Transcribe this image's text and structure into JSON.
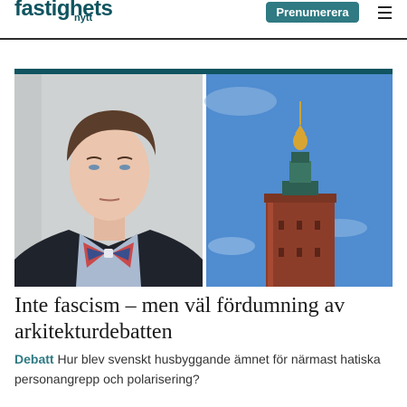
{
  "header": {
    "logo_main": "fastighets",
    "logo_sub": "nytt",
    "subscribe_label": "Prenumerera",
    "menu_icon": "hamburger-menu-icon"
  },
  "article": {
    "image_description": "portrait-of-man-with-bow-tie-and-stockholm-city-hall-tower",
    "title": "Inte fascism – men väl fördumning av arkitekturdebatten",
    "category": "Debatt",
    "lead": "Hur blev svenskt husbyggande ämnet för närmast hatiska personangrepp och polarisering?"
  },
  "colors": {
    "brand": "#0f5460",
    "button": "#2f7a83",
    "category": "#2f7a83"
  }
}
